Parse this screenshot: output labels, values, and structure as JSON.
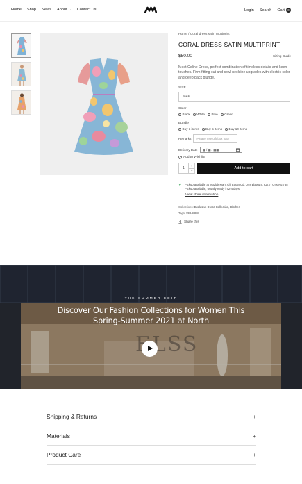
{
  "header": {
    "nav": [
      "Home",
      "Shop",
      "News",
      "About",
      "Contact Us"
    ],
    "about_caret": "⌄",
    "login": "Login",
    "search": "Search",
    "cart": "Cart",
    "cart_count": "0"
  },
  "product": {
    "breadcrumb_home": "Home",
    "breadcrumb_sep": "/",
    "breadcrumb_current": "Coral dress satin multiprint",
    "title": "CORAL DRESS SATIN MULTIPRINT",
    "price": "$50.00",
    "sizing_guide": "Sizing Guide",
    "description": "Meet Celine Dress, perfect combination of timeless details and keen touches. Firm-fitting cut and cowl neckline upgrades with electric color and deep back plunge.",
    "size_label": "SIZE",
    "size_placeholder": "SIZE",
    "color_label": "Color",
    "colors": [
      "Black",
      "White",
      "Blue",
      "Green"
    ],
    "bundle_label": "Bundle",
    "bundles": [
      "Buy 3 items",
      "Buy 5 items",
      "Buy 10 items"
    ],
    "remarks_label": "Remarks",
    "remarks_placeholder": "Please use gift box pac!",
    "delivery_label": "Delivery Date",
    "date_value": "▦ / ▦ / ▦▦",
    "wishlist": "Add to Wishlist",
    "qty": "1",
    "qty_plus": "+",
    "qty_minus": "−",
    "add_to_cart": "Add to cart",
    "pickup_line": "Pickup available at Mozlak Mah. Ahi Evran Cd. O4s Blatsu 4. Kat 7. O4s No:788",
    "pickup_time": "Pickup available, usually ready in 2-4 days",
    "store_info": "View store information",
    "collections_label": "Collections:",
    "collections": "Exclusive Dress Collection, Clothes",
    "tags_label": "Tags:",
    "tags": "999.9888",
    "share": "Share this"
  },
  "banner": {
    "eyebrow": "THE SUMMER EDIT",
    "heading_line1": "Discover Our Fashion Collections for Women This",
    "heading_line2": "Spring-Summer 2021 at North",
    "storefront_letters": "ELSS"
  },
  "accordion": [
    "Shipping & Returns",
    "Materials",
    "Product Care"
  ],
  "accordion_icon": "+",
  "colors": {
    "accent": "#111111",
    "check": "#2a9d4a",
    "banner_bg": "#2a3140"
  }
}
